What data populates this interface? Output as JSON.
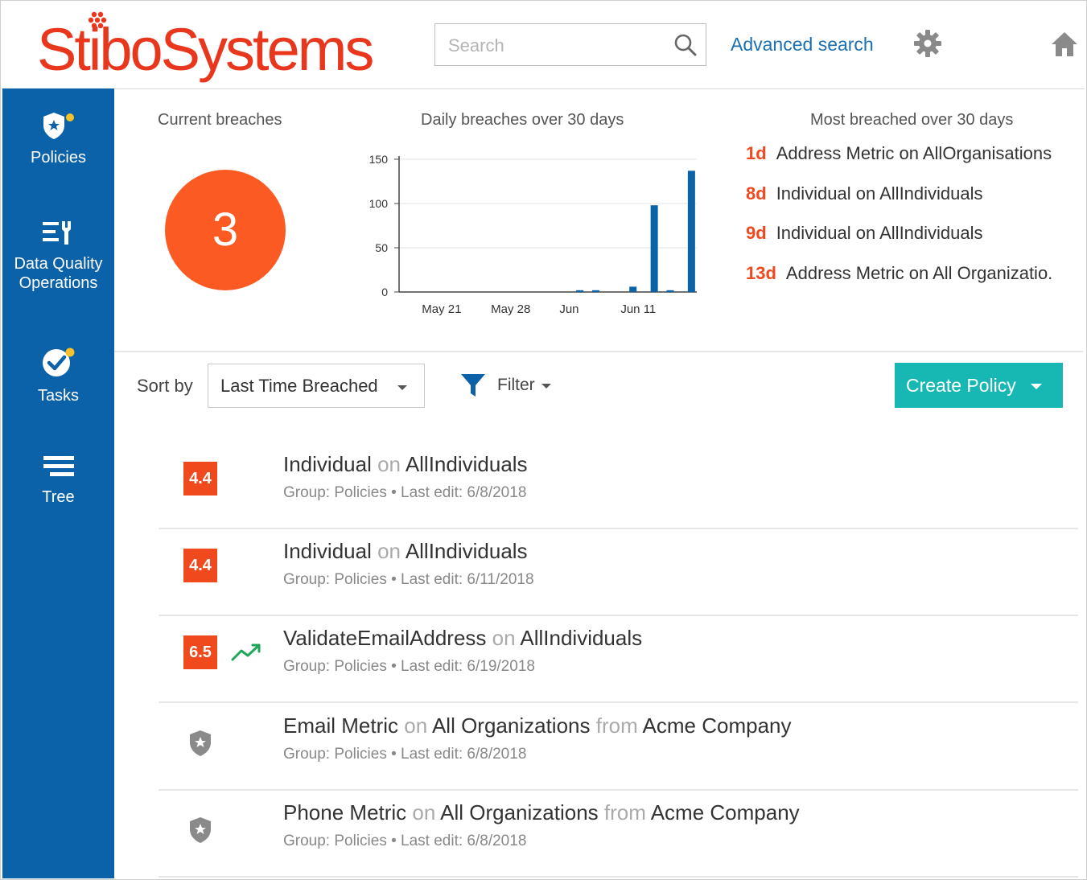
{
  "header": {
    "logo_text": "StiboSystems",
    "search_placeholder": "Search",
    "advanced_search_label": "Advanced search"
  },
  "sidebar": {
    "items": [
      {
        "label": "Policies",
        "icon": "shield-star-icon"
      },
      {
        "label": "Data Quality",
        "label2": "Operations",
        "icon": "list-tools-icon"
      },
      {
        "label": "Tasks",
        "icon": "check-badge-icon"
      },
      {
        "label": "Tree",
        "icon": "tree-list-icon"
      }
    ]
  },
  "current_breaches": {
    "title": "Current breaches",
    "count": "3"
  },
  "chart_data": {
    "type": "bar",
    "title": "Daily breaches over 30 days",
    "xlabel": "",
    "ylabel": "",
    "ylim": [
      0,
      150
    ],
    "yticks": [
      "0",
      "50",
      "100",
      "150"
    ],
    "xtick_labels": [
      "May 21",
      "May 28",
      "Jun",
      "Jun 11"
    ],
    "xtick_positions": [
      3,
      9.5,
      15,
      21.5
    ],
    "x": [
      16,
      17.5,
      21,
      23,
      24.5,
      26.5
    ],
    "values": [
      2,
      2,
      6,
      98,
      2,
      137
    ],
    "xlim": [
      -1,
      27
    ],
    "color": "#0b62a8",
    "grid": true
  },
  "most_breached": {
    "title": "Most breached over 30 days",
    "items": [
      {
        "days": "1d",
        "text": "Address Metric on AllOrganisations"
      },
      {
        "days": "8d",
        "text": "Individual on AllIndividuals"
      },
      {
        "days": "9d",
        "text": "Individual on AllIndividuals"
      },
      {
        "days": "13d",
        "text": "Address Metric on All Organizatio."
      }
    ]
  },
  "toolbar": {
    "sort_label": "Sort by",
    "sort_value": "Last Time Breached",
    "filter_label": "Filter",
    "create_label": "Create Policy"
  },
  "colors": {
    "brand": "#e8371c",
    "sidebar": "#0b62a8",
    "badge": "#f0491d",
    "accent": "#17b8b4",
    "link": "#1c6fb0"
  },
  "policies": [
    {
      "score": "4.4",
      "name": "Individual",
      "on": "on",
      "target": "AllIndividuals",
      "sub": "Group: Policies • Last edit: 6/8/2018"
    },
    {
      "score": "4.4",
      "name": "Individual",
      "on": "on",
      "target": "AllIndividuals",
      "sub": "Group: Policies • Last edit: 6/11/2018"
    },
    {
      "score": "6.5",
      "name": "ValidateEmailAddress",
      "on": "on",
      "target": "AllIndividuals",
      "sub": "Group: Policies • Last edit: 6/19/2018",
      "trend": "trending-up-icon"
    },
    {
      "name": "Email Metric",
      "on": "on",
      "target": "All Organizations",
      "from": "from",
      "source": "Acme Company",
      "sub": "Group: Policies • Last edit: 6/8/2018"
    },
    {
      "name": "Phone Metric",
      "on": "on",
      "target": "All Organizations",
      "from": "from",
      "source": "Acme Company",
      "sub": "Group: Policies • Last edit: 6/8/2018"
    }
  ]
}
